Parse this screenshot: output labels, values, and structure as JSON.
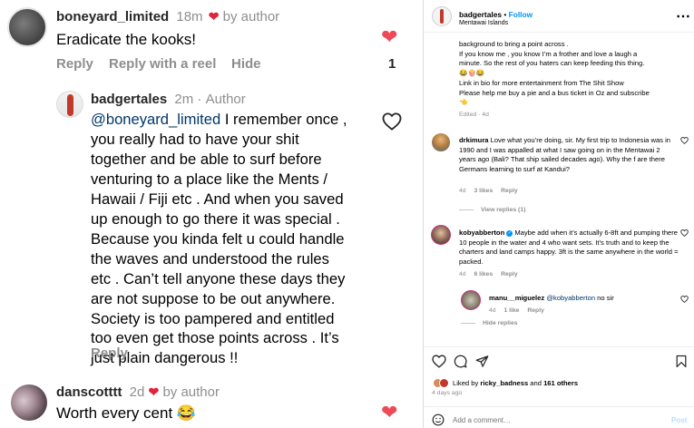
{
  "left": {
    "comment1": {
      "username": "boneyard_limited",
      "time": "18m",
      "by_author": "by author",
      "text": "Eradicate the kooks!",
      "reply": "Reply",
      "reply_reel": "Reply with a reel",
      "hide": "Hide",
      "like_count": "1"
    },
    "reply1": {
      "username": "badgertales",
      "time": "2m",
      "author_label": "Author",
      "mention": "@boneyard_limited",
      "text": " I remember once ,\nyou really had to have your shit\ntogether and be able to surf before\nventuring to a place like the Ments /\nHawaii / Fiji etc . And when you saved\nup enough to go there it was special .\nBecause you kinda felt u could handle\nthe waves and understood the rules\netc . Can’t tell anyone these days they\nare not suppose to be out anywhere.\nSociety is too pampered and entitled\ntoo even get those points across . It’s\njust plain dangerous !!",
      "reply": "Reply"
    },
    "comment2": {
      "username": "danscotttt",
      "time": "2d",
      "by_author": "by author",
      "text": "Worth every cent",
      "emoji": "😂"
    }
  },
  "right": {
    "header": {
      "username": "badgertales",
      "dot": "•",
      "follow": "Follow",
      "location": "Mentawai Islands",
      "more": "⋯"
    },
    "caption": {
      "lines": [
        "background to bring a point across .",
        "If you know me , you know I’m a frother and love a laugh a",
        "minute. So the rest of you haters can keep feeding this thing.",
        "😂🍿😂",
        "Link in bio for more entertainment from The Shit Show",
        "Please help me buy a pie and a bus ticket in Oz and subscribe",
        "👈"
      ],
      "edited": "Edited · 4d"
    },
    "comments": [
      {
        "username": "drkimura",
        "text": " Love what you’re doing, sir. My first trip to Indonesia was in 1990 and I was appalled at what I saw going on in the Mentawai 2 years ago (Bali? That ship sailed decades ago). Why the f are there Germans learning to surf at Kandui?",
        "time": "4d",
        "likes": "3 likes",
        "reply": "Reply",
        "view_replies": "View replies (1)"
      },
      {
        "username": "kobyabberton",
        "verified": true,
        "text": " Maybe add when it’s actually 6-8ft and pumping there 10 people in the water and 4 who want sets. It’s truth and to keep the charters and land camps happy. 3ft is the same anywhere in the world = packed.",
        "time": "4d",
        "likes": "6 likes",
        "reply": "Reply"
      }
    ],
    "nested_reply": {
      "username": "manu__miguelez",
      "mention": "@kobyabberton",
      "text": " no sir",
      "time": "4d",
      "likes": "1 like",
      "reply": "Reply",
      "hide_replies": "Hide replies"
    },
    "footer": {
      "liked_by_prefix": "Liked by ",
      "liked_by_user": "ricky_badness",
      "liked_by_and": " and ",
      "liked_by_others": "161 others",
      "time": "4 days ago",
      "add_comment_placeholder": "Add a comment…",
      "post": "Post"
    },
    "colors": {
      "accent_blue": "#0095f6",
      "like_red": "#ed4956",
      "gray": "#8e8e8e"
    }
  }
}
